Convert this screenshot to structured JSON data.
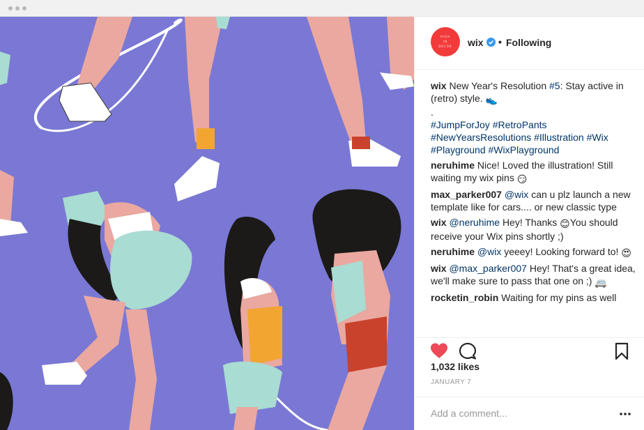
{
  "colors": {
    "image_background": "#7a78d4",
    "avatar_bg": "#f23a3a",
    "link": "#003569",
    "like_red": "#ed4956",
    "verified_blue": "#3897f0",
    "muted": "#999999"
  },
  "icons": [
    "verified-badge-icon",
    "heart-icon",
    "comment-icon",
    "bookmark-icon",
    "more-options-icon"
  ],
  "header": {
    "avatar_text_1": "HIGH",
    "avatar_text_2": "IN",
    "avatar_text_3": "DECOR",
    "username": "wix",
    "separator": "•",
    "follow_status": "Following"
  },
  "caption": {
    "username": "wix",
    "text_1": "New Year's Resolution",
    "tag_1": "#5",
    "text_2": ": Stay active in (retro) style.",
    "emoji": "👟",
    "dot": ".",
    "hashtags_line_1": "#JumpForJoy #RetroPants",
    "hashtags_line_2": "#NewYearsResolutions #Illustration #Wix",
    "hashtags_line_3": "#Playground #WixPlayground"
  },
  "comments": [
    {
      "user": "neruhime",
      "mention": "",
      "text": "Nice! Loved the illustration! Still waiting my wix pins",
      "emoji": "😏"
    },
    {
      "user": "max_parker007",
      "mention": "@wix",
      "text": "can u plz launch a new template like for cars.... or new classic type",
      "emoji": ""
    },
    {
      "user": "wix",
      "mention": "@neruhime",
      "text": "Hey! Thanks",
      "emoji": "😊",
      "text_after": "You should receive your Wix pins shortly ;)"
    },
    {
      "user": "neruhime",
      "mention": "@wix",
      "text": "yeeey! Looking forward to!",
      "emoji": "😍"
    },
    {
      "user": "wix",
      "mention": "@max_parker007",
      "text": "Hey! That's a great idea, we'll make sure to pass that one on ;)",
      "emoji": "🚐"
    },
    {
      "user": "rocketin_robin",
      "mention": "",
      "text": "Waiting for my pins as well",
      "emoji": ""
    }
  ],
  "actions": {
    "likes": "1,032 likes",
    "date": "JANUARY 7"
  },
  "add_comment": {
    "placeholder": "Add a comment..."
  }
}
